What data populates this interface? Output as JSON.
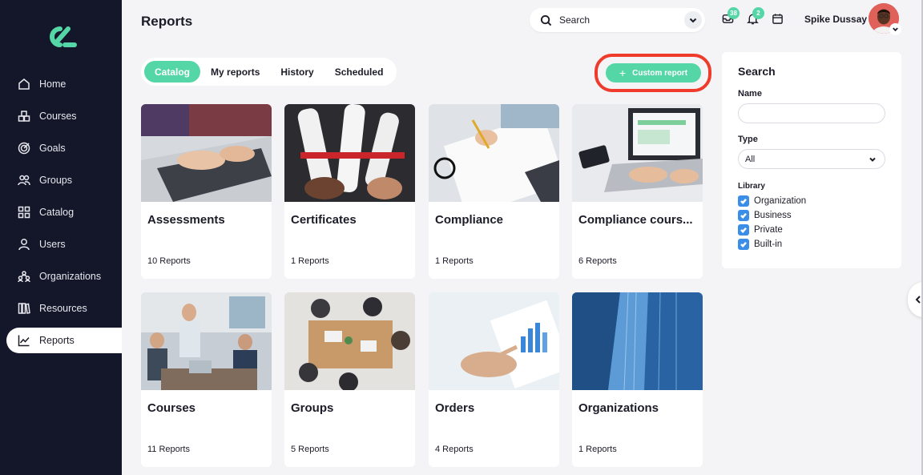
{
  "header": {
    "title": "Reports",
    "search_placeholder": "Search",
    "notifications": {
      "messages_count": "38",
      "alerts_count": "2"
    },
    "user_name": "Spike Dussay"
  },
  "sidebar": {
    "items": [
      {
        "label": "Home",
        "icon": "home-icon"
      },
      {
        "label": "Courses",
        "icon": "courses-icon"
      },
      {
        "label": "Goals",
        "icon": "goals-icon"
      },
      {
        "label": "Groups",
        "icon": "groups-icon"
      },
      {
        "label": "Catalog",
        "icon": "catalog-icon"
      },
      {
        "label": "Users",
        "icon": "user-icon"
      },
      {
        "label": "Organizations",
        "icon": "organizations-icon"
      },
      {
        "label": "Resources",
        "icon": "resources-icon"
      },
      {
        "label": "Reports",
        "icon": "reports-icon",
        "active": true
      }
    ]
  },
  "tabs": [
    {
      "label": "Catalog",
      "active": true
    },
    {
      "label": "My reports"
    },
    {
      "label": "History"
    },
    {
      "label": "Scheduled"
    }
  ],
  "actions": {
    "custom_report_label": "Custom report"
  },
  "cards": [
    {
      "title": "Assessments",
      "count": "10 Reports"
    },
    {
      "title": "Certificates",
      "count": "1 Reports"
    },
    {
      "title": "Compliance",
      "count": "1 Reports"
    },
    {
      "title": "Compliance cours...",
      "count": "6 Reports"
    },
    {
      "title": "Courses",
      "count": "11 Reports"
    },
    {
      "title": "Groups",
      "count": "5 Reports"
    },
    {
      "title": "Orders",
      "count": "4 Reports"
    },
    {
      "title": "Organizations",
      "count": "1 Reports"
    }
  ],
  "filter": {
    "heading": "Search",
    "name_label": "Name",
    "name_value": "",
    "type_label": "Type",
    "type_value": "All",
    "library_label": "Library",
    "library_options": [
      {
        "label": "Organization",
        "checked": true
      },
      {
        "label": "Business",
        "checked": true
      },
      {
        "label": "Private",
        "checked": true
      },
      {
        "label": "Built-in",
        "checked": true
      }
    ]
  },
  "colors": {
    "accent": "#55d6a6",
    "sidebar": "#141729",
    "highlight": "#ef3b2c",
    "checkbox": "#3b8ee8"
  }
}
